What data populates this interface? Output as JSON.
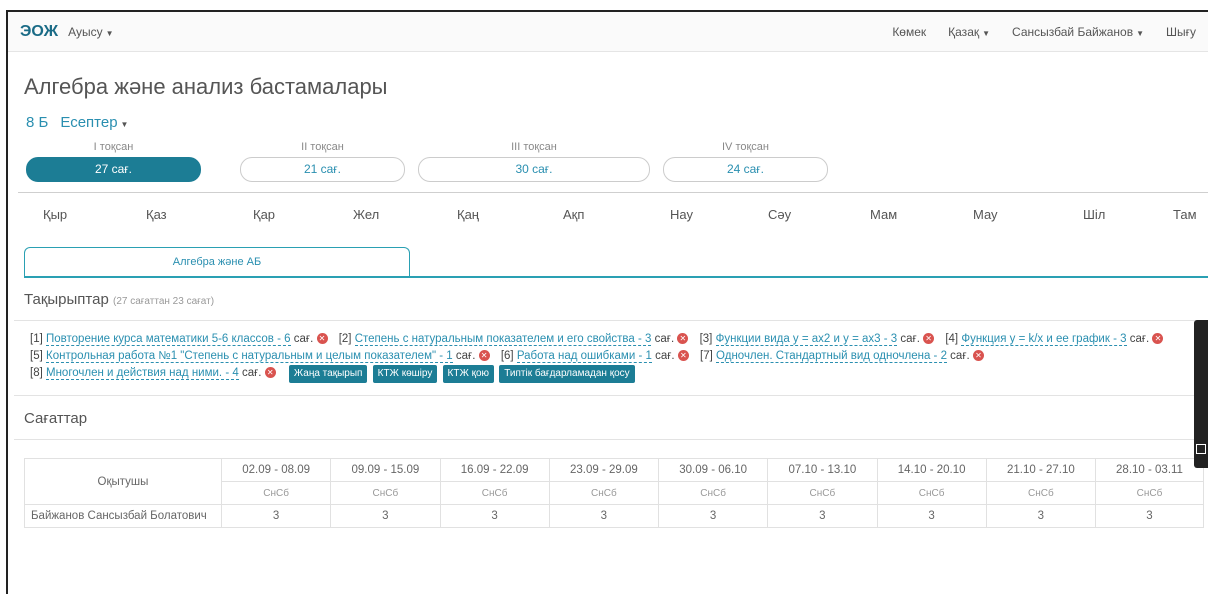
{
  "nav": {
    "brand": "ЭОЖ",
    "menu": "Ауысу",
    "help": "Көмек",
    "language": "Қазақ",
    "user": "Сансызбай Байжанов",
    "logout": "Шығу"
  },
  "page": {
    "title": "Алгебра және анализ бастамалары",
    "class_name": "8 Б",
    "reports_label": "Есептер"
  },
  "quarters": [
    {
      "label": "I тоқсан",
      "hours": "27 сағ.",
      "active": true
    },
    {
      "label": "II тоқсан",
      "hours": "21 сағ.",
      "active": false
    },
    {
      "label": "III тоқсан",
      "hours": "30 сағ.",
      "active": false
    },
    {
      "label": "IV тоқсан",
      "hours": "24 сағ.",
      "active": false
    }
  ],
  "months": [
    "Қыр",
    "Қаз",
    "Қар",
    "Жел",
    "Қаң",
    "Ақп",
    "Нау",
    "Сәу",
    "Мам",
    "Мау",
    "Шіл",
    "Там"
  ],
  "tab": {
    "label": "Алгебра және АБ"
  },
  "topics_section": {
    "title": "Тақырыптар",
    "subtitle": "(27 сағаттан 23 сағат)"
  },
  "topics": [
    {
      "num": "[1]",
      "title": "Повторение курса математики 5-6  классов - 6",
      "unit": "сағ."
    },
    {
      "num": "[2]",
      "title": "Степень с натуральным показателем и его свойства - 3",
      "unit": "сағ."
    },
    {
      "num": "[3]",
      "title": "Функции вида y = ax2 и y = ax3 - 3",
      "unit": "сағ."
    },
    {
      "num": "[4]",
      "title": "Функция y = k/x и ее график - 3",
      "unit": "сағ."
    },
    {
      "num": "[5]",
      "title": "Контрольная работа №1 \"Степень с натуральным и целым показателем\" - 1",
      "unit": "сағ."
    },
    {
      "num": "[6]",
      "title": "Работа над ошибками - 1",
      "unit": "сағ."
    },
    {
      "num": "[7]",
      "title": "Одночлен. Стандартный вид одночлена - 2",
      "unit": "сағ."
    },
    {
      "num": "[8]",
      "title": "Многочлен и действия над ними. - 4",
      "unit": "сағ."
    }
  ],
  "topic_buttons": [
    "Жаңа тақырып",
    "КТЖ көшіру",
    "КТЖ қою",
    "Типтік бағдарламадан қосу"
  ],
  "hours_section": {
    "title": "Сағаттар"
  },
  "hours_table": {
    "teacher_header": "Оқытушы",
    "weeks": [
      "02.09 - 08.09",
      "09.09 - 15.09",
      "16.09 - 22.09",
      "23.09 - 29.09",
      "30.09 - 06.10",
      "07.10 - 13.10",
      "14.10 - 20.10",
      "21.10 - 27.10",
      "28.10 - 03.11"
    ],
    "week_sub": "СнСб",
    "rows": [
      {
        "teacher": "Байжанов Сансызбай Болатович",
        "values": [
          "3",
          "3",
          "3",
          "3",
          "3",
          "3",
          "3",
          "3",
          "3"
        ]
      }
    ]
  },
  "colors": {
    "accent": "#1c7d95",
    "link": "#2a8fb0",
    "delete": "#d9534f"
  }
}
